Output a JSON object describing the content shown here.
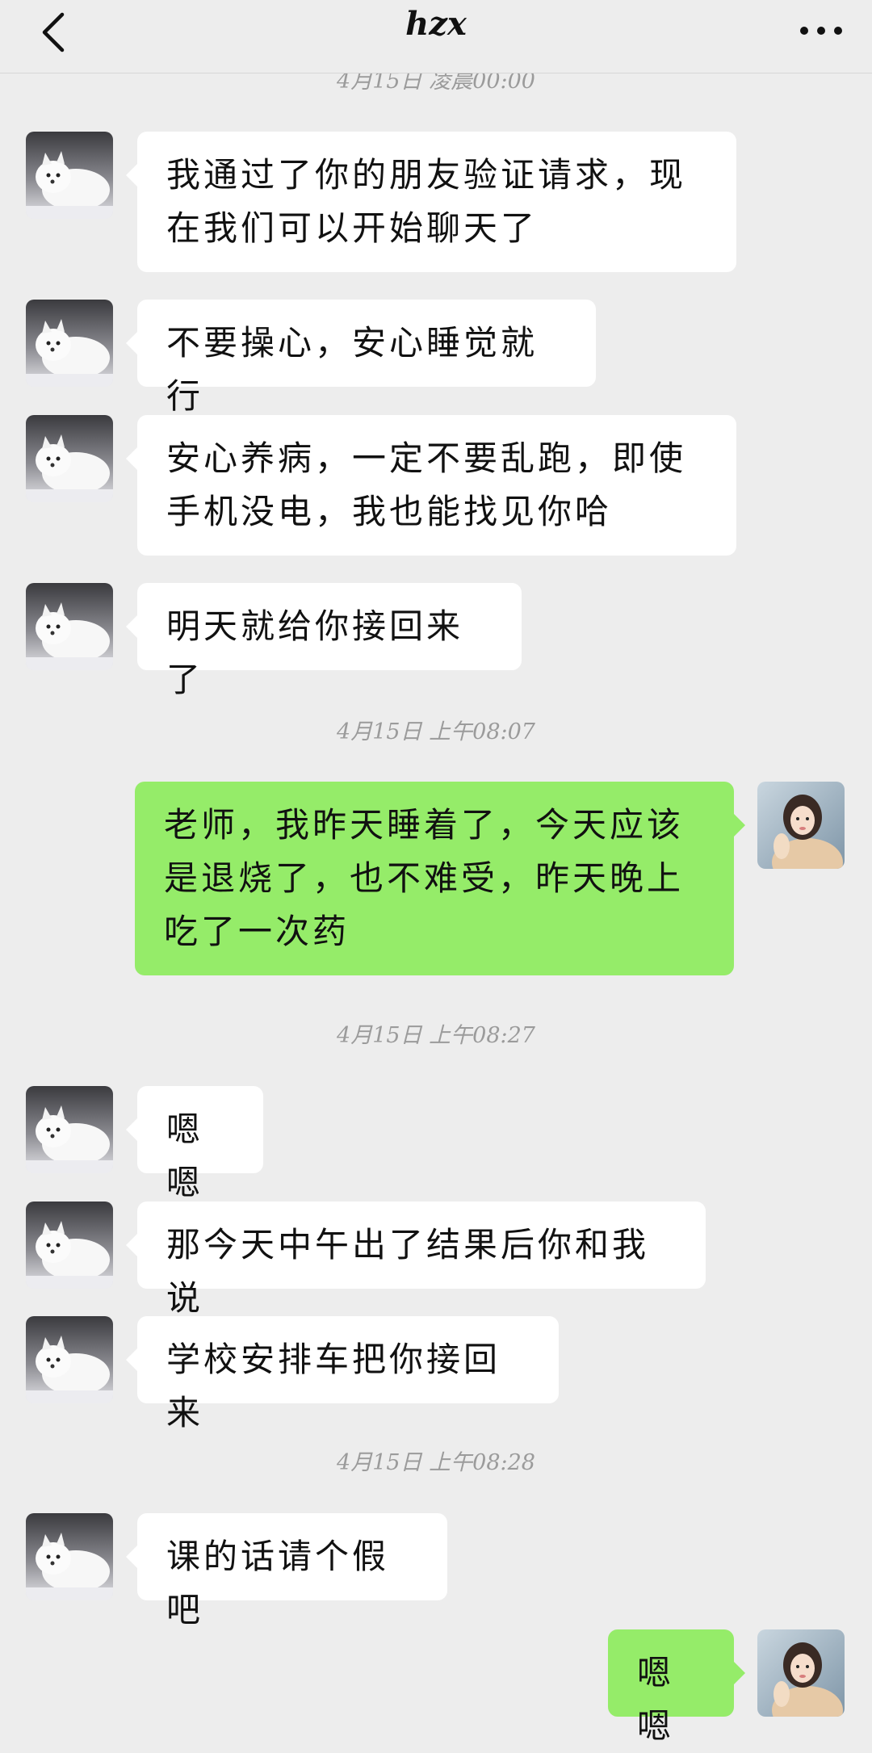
{
  "header": {
    "title": "hzx",
    "back_icon": "chevron-left-icon",
    "more_icon": "more-horizontal-icon"
  },
  "timestamps": [
    "4月15日 凌晨00:00",
    "4月15日 上午08:07",
    "4月15日 上午08:27",
    "4月15日 上午08:28"
  ],
  "messages": [
    {
      "side": "left",
      "text": "我通过了你的朋友验证请求，现在我们可以开始聊天了"
    },
    {
      "side": "left",
      "text": "不要操心，安心睡觉就行"
    },
    {
      "side": "left",
      "text": "安心养病，一定不要乱跑，即使手机没电，我也能找见你哈"
    },
    {
      "side": "left",
      "text": "明天就给你接回来了"
    },
    {
      "side": "right",
      "text": "老师，我昨天睡着了，今天应该是退烧了，也不难受，昨天晚上吃了一次药"
    },
    {
      "side": "left",
      "text": "嗯嗯"
    },
    {
      "side": "left",
      "text": "那今天中午出了结果后你和我说"
    },
    {
      "side": "left",
      "text": "学校安排车把你接回来"
    },
    {
      "side": "left",
      "text": "课的话请个假吧"
    },
    {
      "side": "right",
      "text": "嗯嗯"
    }
  ],
  "colors": {
    "background": "#ededed",
    "incoming_bubble": "#ffffff",
    "outgoing_bubble": "#95ec69",
    "timestamp": "#9b9b9b"
  }
}
